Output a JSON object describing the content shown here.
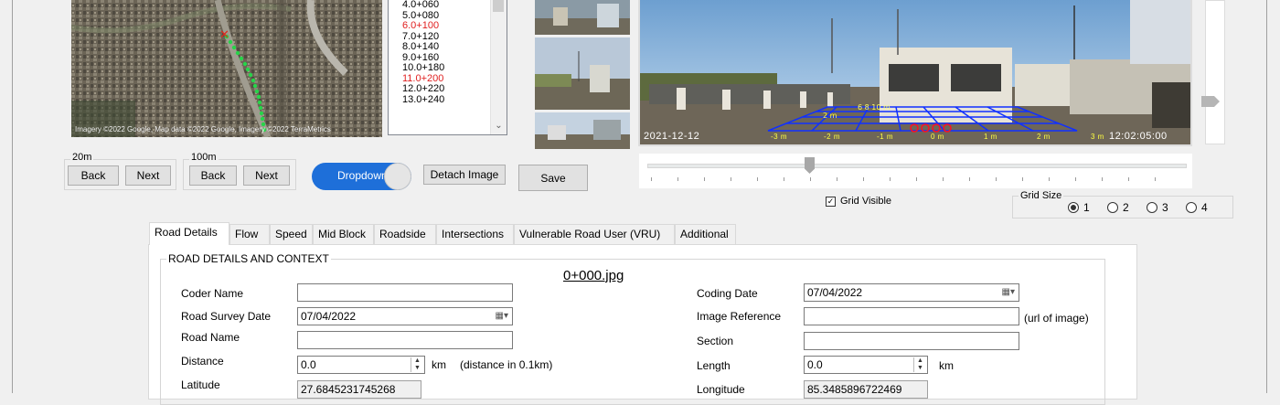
{
  "map": {
    "credit": "Imagery ©2022 Google, Map data ©2022 Google, Imagery ©2022 TerraMetrics"
  },
  "chainage_list": {
    "items": [
      {
        "label": "4.0+060",
        "red": false
      },
      {
        "label": "5.0+080",
        "red": false
      },
      {
        "label": "6.0+100",
        "red": true
      },
      {
        "label": "7.0+120",
        "red": false
      },
      {
        "label": "8.0+140",
        "red": false
      },
      {
        "label": "9.0+160",
        "red": false
      },
      {
        "label": "10.0+180",
        "red": false
      },
      {
        "label": "11.0+200",
        "red": true
      },
      {
        "label": "12.0+220",
        "red": false
      },
      {
        "label": "13.0+240",
        "red": false
      }
    ]
  },
  "main_image": {
    "date_stamp": "2021-12-12",
    "time_stamp": "12:02:05:00",
    "grid_labels": [
      "-3 m",
      "-2 m",
      "-1 m",
      "0 m",
      "1 m",
      "2 m",
      "3 m"
    ],
    "grid_far_label": "2 m",
    "grid_top_label": "6 8 10 m"
  },
  "nav": {
    "group1_label": "20m",
    "group2_label": "100m",
    "back": "Back",
    "next": "Next"
  },
  "toolbar": {
    "dropdown_toggle": "Dropdown",
    "detach_image": "Detach Image",
    "save": "Save"
  },
  "grid": {
    "visible_label": "Grid Visible",
    "visible_checked": true,
    "size_label": "Grid Size",
    "options": [
      "1",
      "2",
      "3",
      "4"
    ],
    "selected": "1"
  },
  "tabs": [
    "Road Details",
    "Flow",
    "Speed",
    "Mid Block",
    "Roadside",
    "Intersections",
    "Vulnerable Road User (VRU)",
    "Additional"
  ],
  "active_tab": "Road Details",
  "form": {
    "section_title": "ROAD DETAILS AND CONTEXT",
    "file_name": "0+000.jpg",
    "coder_name_label": "Coder Name",
    "coder_name_value": "",
    "road_survey_date_label": "Road Survey Date",
    "road_survey_date_value": "07/04/2022",
    "road_name_label": "Road Name",
    "road_name_value": "",
    "distance_label": "Distance",
    "distance_value": "0.0",
    "distance_unit": "km",
    "distance_hint": "(distance in 0.1km)",
    "latitude_label": "Latitude",
    "latitude_value": "27.6845231745268",
    "coding_date_label": "Coding Date",
    "coding_date_value": "07/04/2022",
    "image_reference_label": "Image Reference",
    "image_reference_value": "",
    "image_reference_hint": "(url of image)",
    "section_label": "Section",
    "section_value": "",
    "length_label": "Length",
    "length_value": "0.0",
    "length_unit": "km",
    "longitude_label": "Longitude",
    "longitude_value": "85.3485896722469"
  }
}
